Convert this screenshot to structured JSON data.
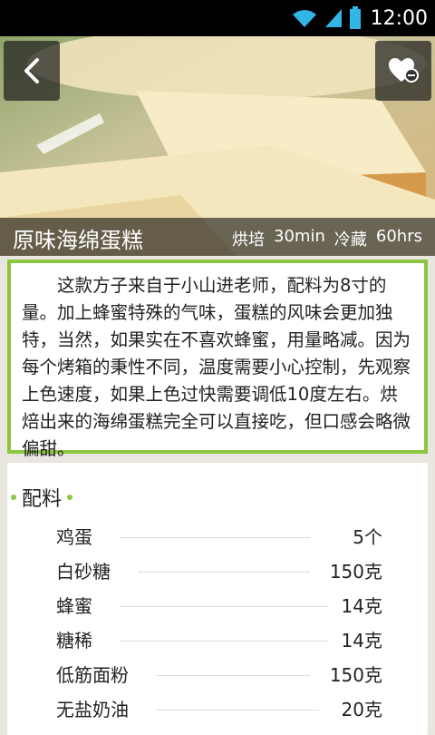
{
  "status_bar": {
    "time": "12:00",
    "icons": [
      "wifi-icon",
      "signal-icon",
      "battery-icon"
    ]
  },
  "header": {
    "title": "原味海绵蛋糕",
    "bake_label": "烘培",
    "bake_time": "30min",
    "chill_label": "冷藏",
    "chill_time": "60hrs"
  },
  "description": "这款方子来自于小山进老师，配料为8寸的量。加上蜂蜜特殊的气味，蛋糕的风味会更加独特，当然，如果实在不喜欢蜂蜜，用量略减。因为每个烤箱的秉性不同，温度需要小心控制，先观察上色速度，如果上色过快需要调低10度左右。烘焙出来的海绵蛋糕完全可以直接吃，但口感会略微偏甜。",
  "ingredients": {
    "heading": "配料",
    "items": [
      {
        "name": "鸡蛋",
        "qty": "5个"
      },
      {
        "name": "白砂糖",
        "qty": "150克"
      },
      {
        "name": "蜂蜜",
        "qty": "14克"
      },
      {
        "name": "糖稀",
        "qty": "14克"
      },
      {
        "name": "低筋面粉",
        "qty": "150克"
      },
      {
        "name": "无盐奶油",
        "qty": "20克"
      }
    ]
  },
  "colors": {
    "accent": "#8cc63f",
    "status_icon": "#33b5e5"
  }
}
